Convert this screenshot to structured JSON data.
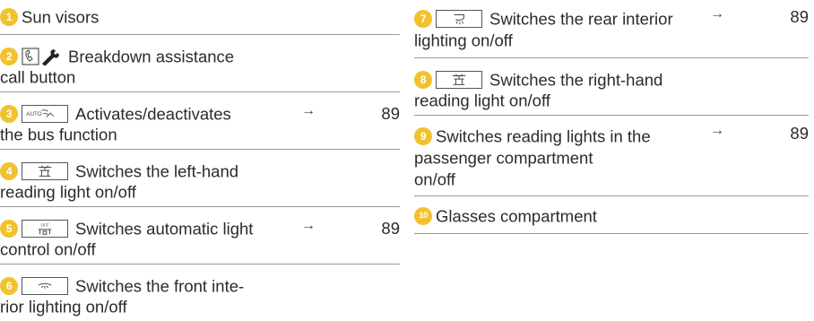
{
  "left_items": [
    {
      "number": "1",
      "lines": [
        "Sun visors"
      ]
    },
    {
      "number": "2",
      "icon": "phone-and-wrench-icons",
      "lines": [
        "Breakdown assistance",
        "call button"
      ]
    },
    {
      "number": "3",
      "icon": "auto-bus-button-icon",
      "lines": [
        "Activates/deactivates",
        "the bus function"
      ],
      "arrow": "→",
      "page": "89"
    },
    {
      "number": "4",
      "icon": "left-reading-light-button-icon",
      "lines": [
        "Switches the left-hand",
        "reading light on/off"
      ]
    },
    {
      "number": "5",
      "icon": "automatic-light-control-button-icon",
      "icon_text": "OFF",
      "lines": [
        "Switches automatic light",
        "control on/off"
      ],
      "arrow": "→",
      "page": "89"
    },
    {
      "number": "6",
      "icon": "front-interior-light-button-icon",
      "lines": [
        "Switches the front inte-",
        "rior lighting on/off"
      ]
    }
  ],
  "right_items": [
    {
      "number": "7",
      "icon": "rear-interior-light-button-icon",
      "lines": [
        "Switches the rear interior",
        "lighting on/off"
      ],
      "arrow": "→",
      "page": "89"
    },
    {
      "number": "8",
      "icon": "right-reading-light-button-icon",
      "lines": [
        "Switches the right-hand",
        "reading light on/off"
      ]
    },
    {
      "number": "9",
      "lines": [
        "Switches reading lights in the",
        "passenger compartment",
        "on/off"
      ],
      "arrow": "→",
      "page": "89"
    },
    {
      "number": "10",
      "lines": [
        "Glasses compartment"
      ]
    }
  ],
  "colors": {
    "number_badge": "#f2c22e",
    "text": "#2b2b2b",
    "divider": "#9a9a9a"
  }
}
